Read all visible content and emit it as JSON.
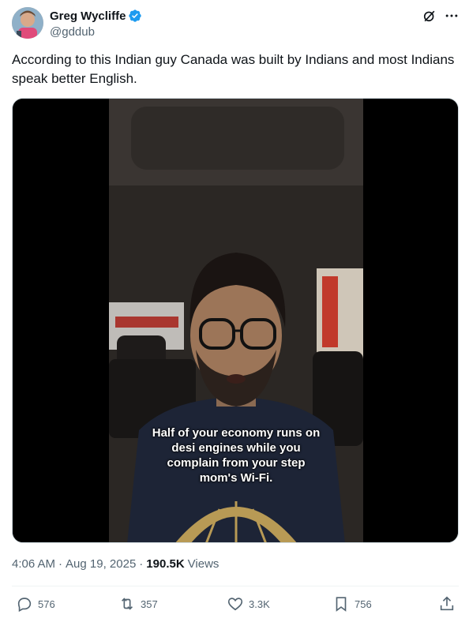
{
  "author": {
    "name": "Greg Wycliffe",
    "handle": "@gddub"
  },
  "tweet": {
    "text": "According to this Indian guy Canada was built by Indians and most Indians speak better English."
  },
  "video": {
    "caption": "Half of your economy runs on desi engines while you complain from your step mom's Wi-Fi."
  },
  "meta": {
    "time": "4:06 AM",
    "separator": "·",
    "date": "Aug 19, 2025",
    "separator2": "·",
    "views_count": "190.5K",
    "views_label": "Views"
  },
  "actions": {
    "replies": "576",
    "reposts": "357",
    "likes": "3.3K",
    "bookmarks": "756"
  },
  "colors": {
    "verified": "#1d9bf0",
    "text": "#0f1419",
    "secondary": "#536471"
  }
}
